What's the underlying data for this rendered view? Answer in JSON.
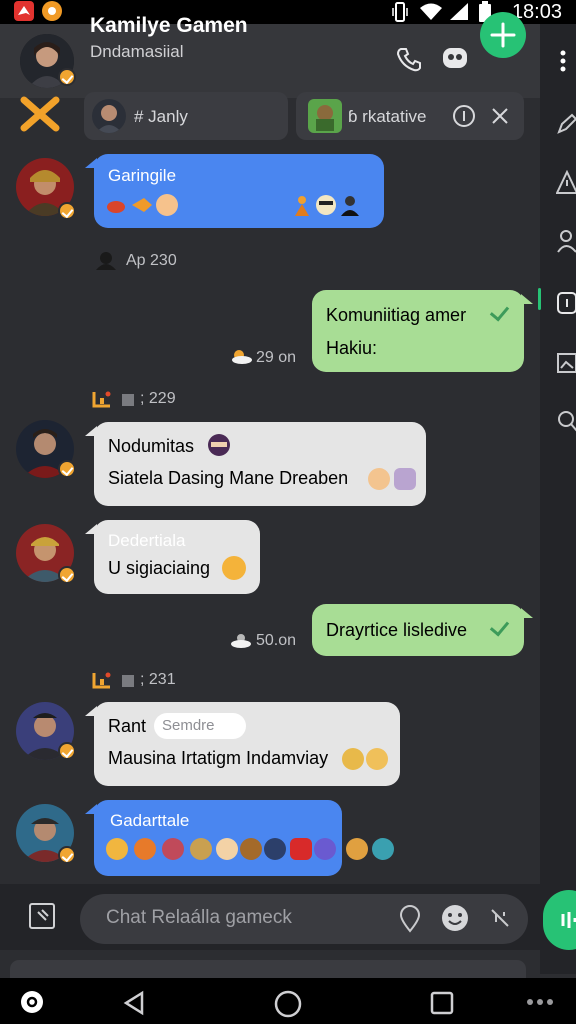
{
  "status_bar": {
    "time": "18:03"
  },
  "header": {
    "title": "Kamilye Gamen",
    "subtitle": "Dndamasiial"
  },
  "chips": [
    {
      "text": "# Janly"
    },
    {
      "text": "ɓ rkatative"
    }
  ],
  "messages": [
    {
      "sender": "Garingile"
    },
    {
      "meta": "Ap 230"
    },
    {
      "text1": "Komuniitiag amer",
      "text2": "Hakiu:"
    },
    {
      "meta": "29 on"
    },
    {
      "meta": "; 229"
    },
    {
      "text1": "Nodumitas",
      "text2": "Siatela Dasing Mane Dreaben"
    },
    {
      "sender": "Dedertiala",
      "text": "U sigiaciaing"
    },
    {
      "text": "Drayrtice lisledive"
    },
    {
      "meta": "50.on"
    },
    {
      "meta": "; 231"
    },
    {
      "text1": "Rant",
      "pill": "Semdre",
      "text2": "Mausina Irtatigm Indamviay"
    },
    {
      "sender": "Gadarttale"
    }
  ],
  "composer": {
    "placeholder": "Chat Relaálla gameck"
  },
  "icons": [
    "phone-icon",
    "voice-chat-icon",
    "plus-icon",
    "more-vertical-icon",
    "pen-icon",
    "warning-icon",
    "user-icon",
    "panel-icon",
    "image-icon",
    "search-icon",
    "attach-image-icon",
    "location-icon",
    "emoji-icon",
    "mute-icon",
    "back-nav-icon",
    "home-nav-icon",
    "recents-nav-icon"
  ],
  "colors": {
    "accent_green": "#27c275",
    "bubble_blue": "#4a86f0",
    "bubble_green": "#a8dd95",
    "bubble_white": "#e5e5e5",
    "background": "#2c2d31"
  }
}
